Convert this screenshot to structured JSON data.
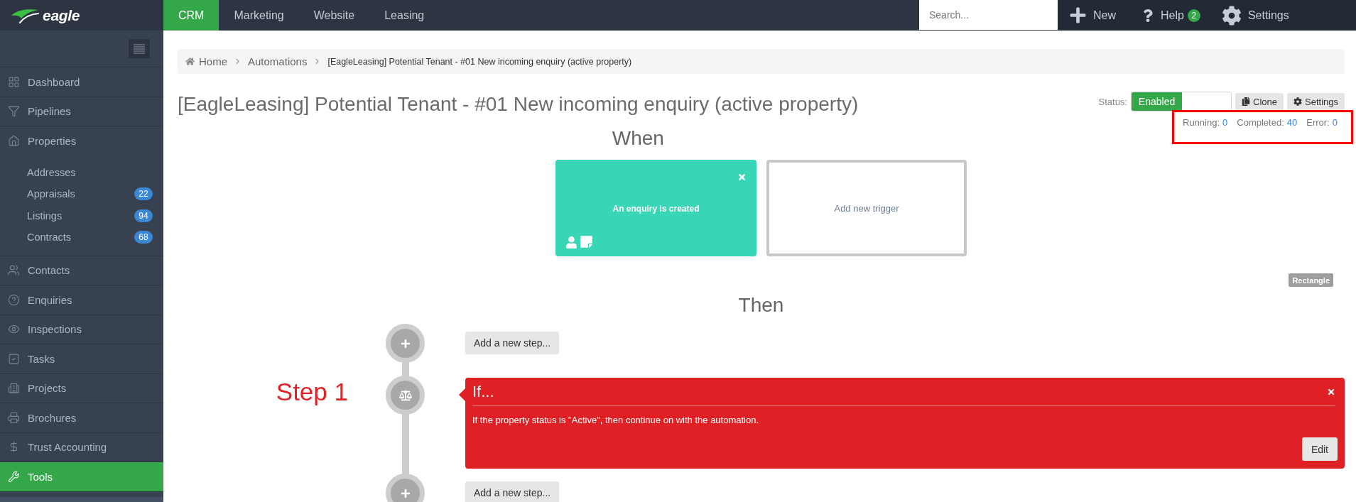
{
  "brand": {
    "name": "eagle"
  },
  "top_nav": {
    "tabs": [
      {
        "label": "CRM",
        "selected": true
      },
      {
        "label": "Marketing",
        "selected": false
      },
      {
        "label": "Website",
        "selected": false
      },
      {
        "label": "Leasing",
        "selected": false
      }
    ],
    "search": {
      "placeholder": "Search..."
    },
    "actions": [
      {
        "kind": "new",
        "label": "New"
      },
      {
        "kind": "help",
        "label": "Help",
        "badge": "2"
      },
      {
        "kind": "settings",
        "label": "Settings"
      }
    ]
  },
  "sidebar": {
    "items": [
      {
        "label": "Dashboard",
        "selected": false
      },
      {
        "label": "Pipelines",
        "selected": false
      },
      {
        "label": "Properties",
        "selected": false,
        "children": [
          {
            "label": "Addresses",
            "selected": false
          },
          {
            "label": "Appraisals",
            "badge": "22",
            "selected": false
          },
          {
            "label": "Listings",
            "badge": "94",
            "selected": false
          },
          {
            "label": "Contracts",
            "badge": "68",
            "selected": false
          }
        ]
      },
      {
        "label": "Contacts",
        "selected": false
      },
      {
        "label": "Enquiries",
        "selected": false
      },
      {
        "label": "Inspections",
        "selected": false
      },
      {
        "label": "Tasks",
        "selected": false
      },
      {
        "label": "Projects",
        "selected": false
      },
      {
        "label": "Brochures",
        "selected": false
      },
      {
        "label": "Trust Accounting",
        "selected": false
      },
      {
        "label": "Tools",
        "selected": true
      }
    ]
  },
  "breadcrumb": [
    "Home",
    "Automations",
    "[EagleLeasing] Potential Tenant - #01 New incoming enquiry (active property)"
  ],
  "page_title": "[EagleLeasing] Potential Tenant - #01 New incoming enquiry (active property)",
  "status": {
    "label": "Status:",
    "toggle": {
      "label": "Enabled",
      "on": true
    },
    "buttons": [
      {
        "kind": "clone",
        "label": "Clone"
      },
      {
        "kind": "settings",
        "label": "Settings"
      }
    ]
  },
  "stats": [
    {
      "label": "Running:",
      "value": "0"
    },
    {
      "label": "Completed:",
      "value": "40"
    },
    {
      "label": "Error:",
      "value": "0"
    }
  ],
  "when": {
    "heading": "When",
    "triggers": [
      {
        "kind": "trigger",
        "label": "An enquiry is created"
      },
      {
        "kind": "add",
        "label": "Add new trigger"
      }
    ]
  },
  "tag": {
    "label": "Rectangle"
  },
  "then": {
    "heading": "Then",
    "timeline": [
      {
        "kind": "add",
        "label": "Add a new step..."
      },
      {
        "kind": "step",
        "step_label": "Step 1",
        "title": "If...",
        "description": "If the property status is \"Active\", then continue on with the automation.",
        "button": "Edit"
      },
      {
        "kind": "add",
        "label": "Add a new step..."
      }
    ]
  }
}
